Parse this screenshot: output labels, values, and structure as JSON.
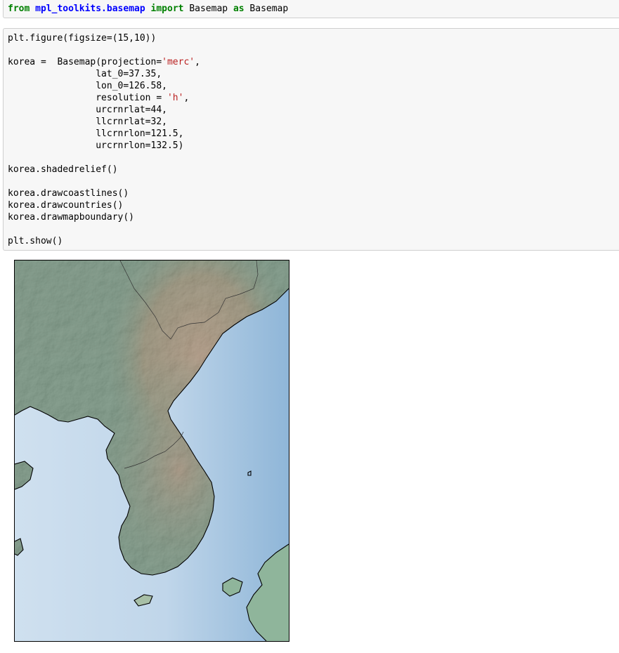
{
  "cell1": {
    "kw_from": "from",
    "module": "mpl_toolkits.basemap",
    "kw_import": "import",
    "name": "Basemap",
    "kw_as": "as",
    "alias": "Basemap"
  },
  "cell2": {
    "line1": "plt.figure(figsize=(15,10))",
    "line2_pre": "korea =  Basemap(projection=",
    "line2_str": "'merc'",
    "line2_post": ",",
    "line3": "                lat_0=37.35,",
    "line4": "                lon_0=126.58,",
    "line5_pre": "                resolution = ",
    "line5_str": "'h'",
    "line5_post": ",",
    "line6": "                urcrnrlat=44,",
    "line7": "                llcrnrlat=32,",
    "line8": "                llcrnrlon=121.5,",
    "line9": "                urcrnrlon=132.5)",
    "line10": "korea.shadedrelief()",
    "line11": "korea.drawcoastlines()",
    "line12": "korea.drawcountries()",
    "line13": "korea.drawmapboundary()",
    "line14": "plt.show()"
  },
  "map_output": {
    "content": "shaded relief map of the Korean peninsula",
    "colors": {
      "sea": "#c3d9ec",
      "sea_deep": "#8fb6d8",
      "land_low": "#8fb59b",
      "land_high": "#d3b496",
      "coastline": "#000000"
    }
  }
}
